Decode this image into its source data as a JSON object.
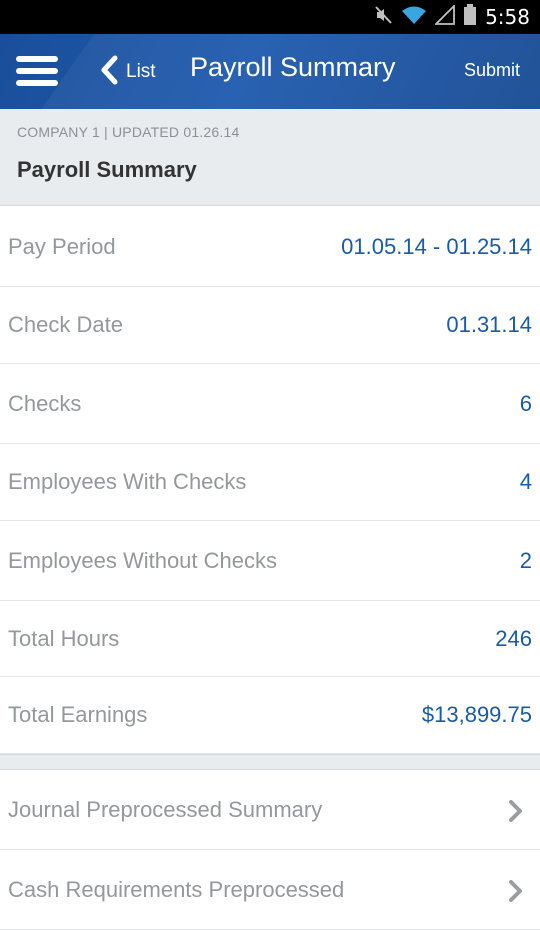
{
  "status_bar": {
    "time": "5:58",
    "icons": [
      "mute-icon",
      "wifi-icon",
      "signal-icon",
      "battery-icon"
    ]
  },
  "header": {
    "menu_icon": "hamburger-menu-icon",
    "back_label": "List",
    "title": "Payroll Summary",
    "submit_label": "Submit",
    "colors": {
      "bar": "#1b51a0",
      "text": "#ffffff"
    }
  },
  "context": {
    "company_line": "COMPANY 1 | UPDATED 01.26.14",
    "title": "Payroll Summary"
  },
  "summary": {
    "rows": [
      {
        "label": "Pay Period",
        "value": "01.05.14 - 01.25.14"
      },
      {
        "label": "Check Date",
        "value": "01.31.14"
      },
      {
        "label": "Checks",
        "value": "6"
      },
      {
        "label": "Employees With Checks",
        "value": "4"
      },
      {
        "label": "Employees Without Checks",
        "value": "2"
      },
      {
        "label": "Total Hours",
        "value": "246"
      },
      {
        "label": "Total Earnings",
        "value": "$13,899.75"
      }
    ],
    "colors": {
      "label": "#94989c",
      "value": "#1b5aa6"
    }
  },
  "reports": {
    "items": [
      {
        "label": "Journal Preprocessed Summary",
        "icon": "chevron-right-icon"
      },
      {
        "label": "Cash Requirements Preprocessed",
        "icon": "chevron-right-icon"
      }
    ]
  }
}
